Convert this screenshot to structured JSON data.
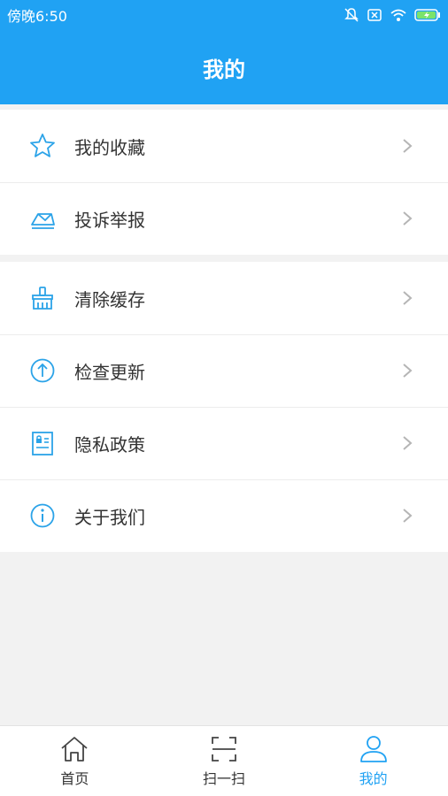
{
  "status_bar": {
    "time": "傍晚6:50",
    "icons": [
      "mute-icon",
      "close-box-icon",
      "wifi-icon",
      "battery-charging-icon"
    ]
  },
  "header": {
    "title": "我的"
  },
  "menu": {
    "group1": [
      {
        "label": "我的收藏",
        "icon": "star-icon"
      },
      {
        "label": "投诉举报",
        "icon": "envelope-icon"
      }
    ],
    "group2": [
      {
        "label": "清除缓存",
        "icon": "broom-icon"
      },
      {
        "label": "检查更新",
        "icon": "arrow-up-circle-icon"
      },
      {
        "label": "隐私政策",
        "icon": "privacy-doc-icon"
      },
      {
        "label": "关于我们",
        "icon": "info-icon"
      }
    ]
  },
  "tabs": [
    {
      "label": "首页",
      "icon": "home-icon",
      "active": false
    },
    {
      "label": "扫一扫",
      "icon": "scan-icon",
      "active": false
    },
    {
      "label": "我的",
      "icon": "user-icon",
      "active": true
    }
  ],
  "colors": {
    "primary": "#20a2f3",
    "icon": "#2ba3e8",
    "background": "#f2f2f2"
  }
}
